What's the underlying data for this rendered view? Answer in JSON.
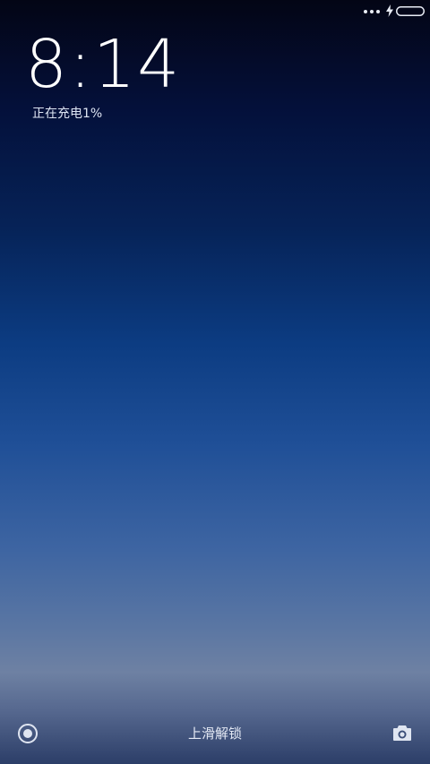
{
  "status_bar": {
    "icons": [
      "more-dots-icon",
      "charging-bolt-icon",
      "battery-icon"
    ],
    "battery_color": "#ffffff"
  },
  "lock_screen": {
    "time": "8:14",
    "charging_status": "正在充电1%"
  },
  "bottom_bar": {
    "left_icon": "record-icon",
    "unlock_hint": "上滑解锁",
    "right_icon": "camera-icon"
  }
}
